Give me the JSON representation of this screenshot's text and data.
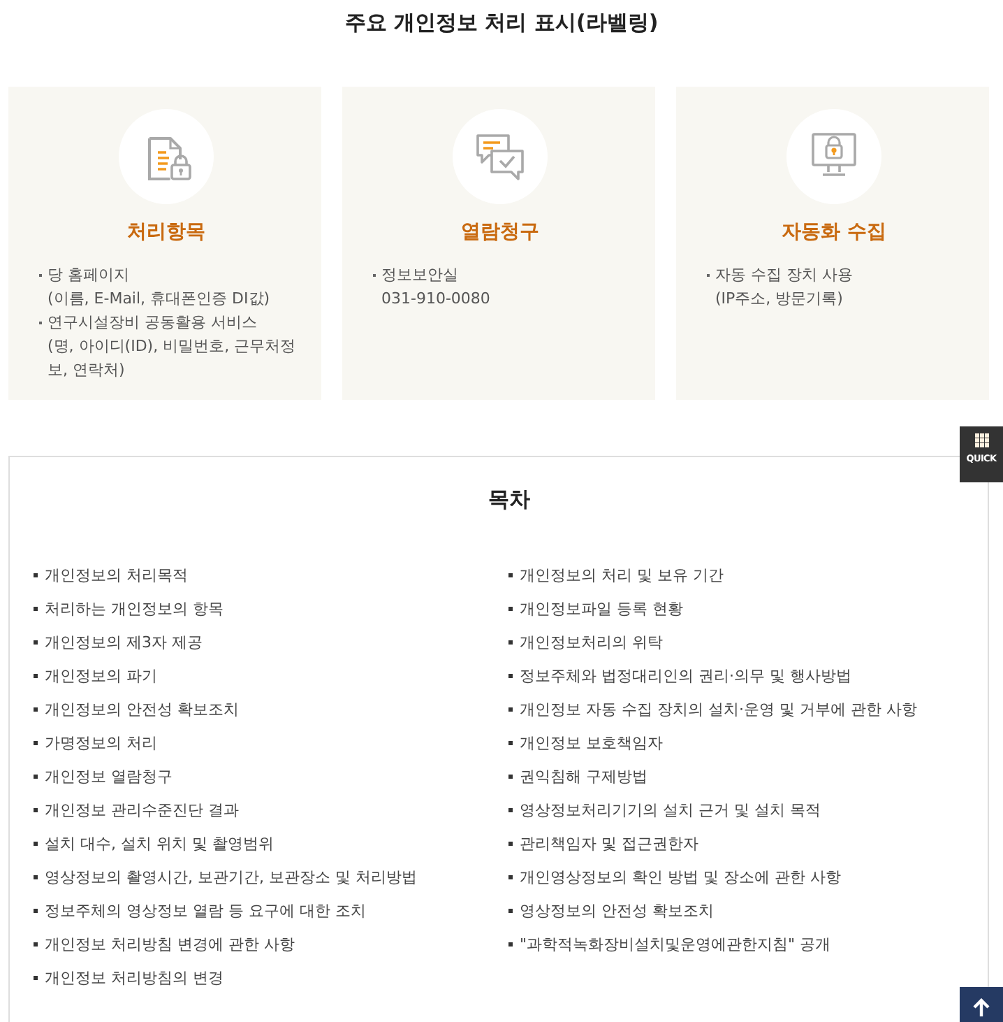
{
  "page_title": "주요 개인정보 처리 표시(라벨링)",
  "labels": [
    {
      "kind": "document",
      "title": "처리항목",
      "items": [
        {
          "label": "당 홈페이지",
          "detail": "(이름, E-Mail, 휴대폰인증 DI값)"
        },
        {
          "label": "연구시설장비 공동활용 서비스",
          "detail": "(명, 아이디(ID), 비밀번호, 근무처정보, 연락처)"
        }
      ]
    },
    {
      "kind": "chat",
      "title": "열람청구",
      "items": [
        {
          "label": "정보보안실",
          "detail": "031-910-0080"
        }
      ]
    },
    {
      "kind": "monitor",
      "title": "자동화 수집",
      "items": [
        {
          "label": "자동 수집 장치 사용",
          "detail": "(IP주소, 방문기록)"
        }
      ]
    }
  ],
  "contents": {
    "title": "목차",
    "columns": [
      [
        "개인정보의 처리목적",
        "처리하는 개인정보의 항목",
        "개인정보의 제3자 제공",
        "개인정보의 파기",
        "개인정보의 안전성 확보조치",
        "가명정보의 처리",
        "개인정보 열람청구",
        "개인정보 관리수준진단 결과",
        "설치 대수, 설치 위치 및 촬영범위",
        "영상정보의 촬영시간, 보관기간, 보관장소 및 처리방법",
        "정보주체의 영상정보 열람 등 요구에 대한 조치",
        "개인정보 처리방침 변경에 관한 사항",
        "개인정보 처리방침의 변경"
      ],
      [
        "개인정보의 처리 및 보유 기간",
        "개인정보파일 등록 현황",
        "개인정보처리의 위탁",
        "정보주체와 법정대리인의 권리·의무 및 행사방법",
        "개인정보 자동 수집 장치의 설치·운영 및 거부에 관한 사항",
        "개인정보 보호책임자",
        "권익침해 구제방법",
        "영상정보처리기기의 설치 근거 및 설치 목적",
        "관리책임자 및 접근권한자",
        "개인영상정보의 확인 방법 및 장소에 관한 사항",
        "영상정보의 안전성 확보조치",
        "\"과학적녹화장비설치및운영에관한지침\" 공개"
      ]
    ]
  },
  "quick_menu": {
    "label": "QUICK"
  }
}
